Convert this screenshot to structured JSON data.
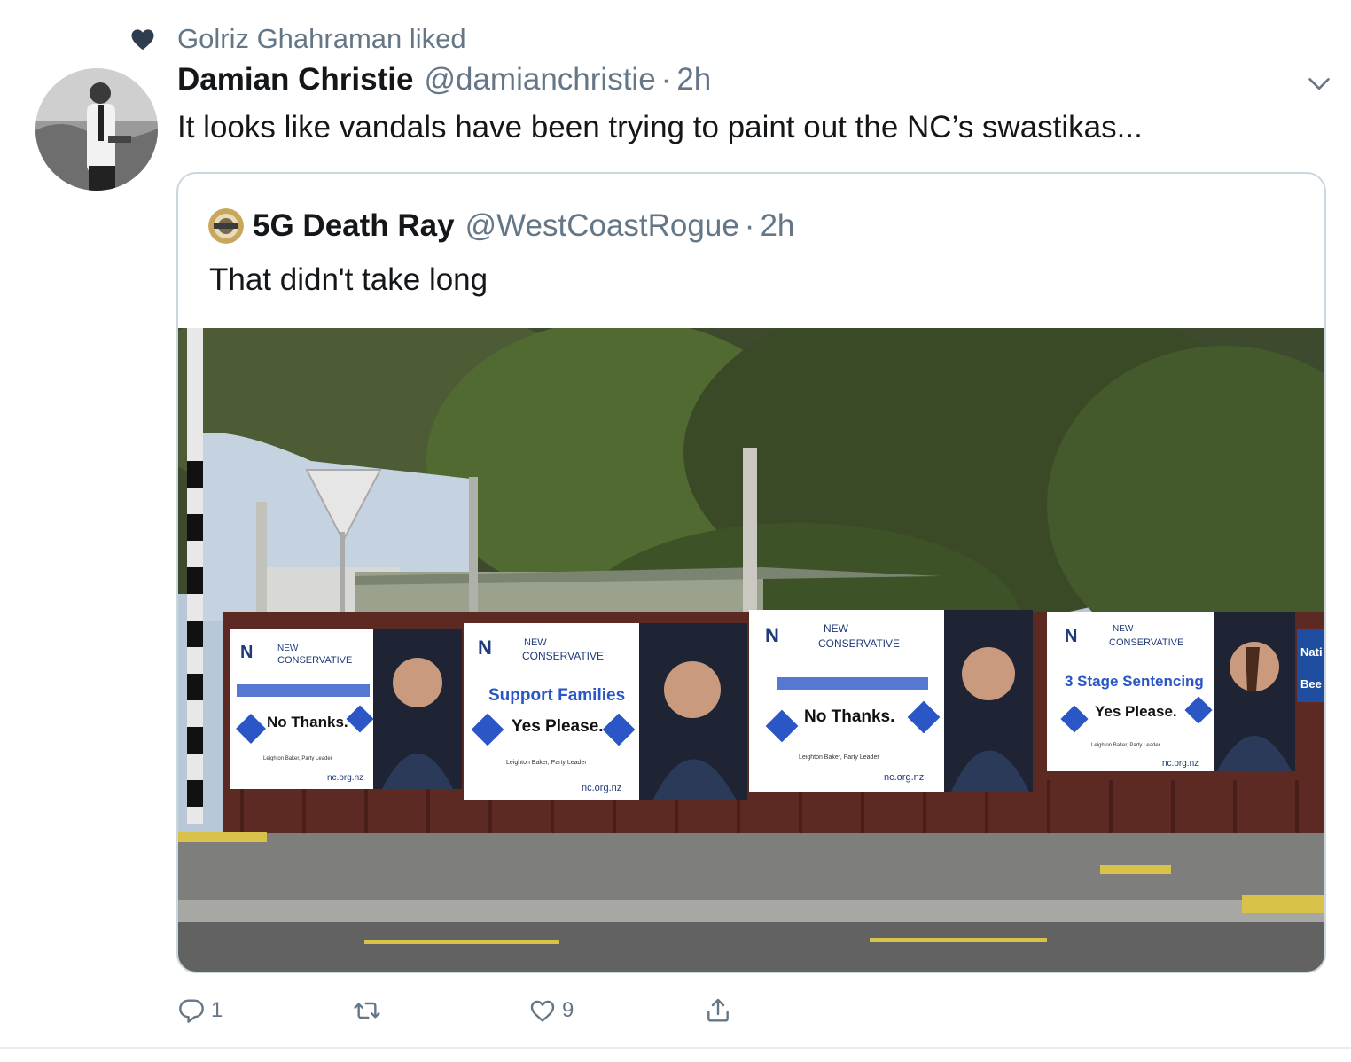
{
  "context": {
    "icon": "heart-icon",
    "text": "Golriz Ghahraman liked"
  },
  "tweet": {
    "author_name": "Damian Christie",
    "author_handle": "@damianchristie",
    "separator": "·",
    "time": "2h",
    "text": "It looks like vandals have been trying to paint out the NC’s swastikas..."
  },
  "quoted": {
    "author_name": "5G Death Ray",
    "author_handle": "@WestCoastRogue",
    "separator": "·",
    "time": "2h",
    "text": "That didn't take long"
  },
  "billboards": [
    {
      "party": "NEW",
      "party2": "CONSERVATIVE",
      "slogan_answer": "No Thanks.",
      "leader": "Leighton Baker, Party Leader",
      "url": "nc.org.nz"
    },
    {
      "party": "NEW",
      "party2": "CONSERVATIVE",
      "slogan": "Support Families",
      "slogan_answer": "Yes Please.",
      "leader": "Leighton Baker, Party Leader",
      "url": "nc.org.nz"
    },
    {
      "party": "NEW",
      "party2": "CONSERVATIVE",
      "slogan_answer": "No Thanks.",
      "leader": "Leighton Baker, Party Leader",
      "url": "nc.org.nz"
    },
    {
      "party": "NEW",
      "party2": "CONSERVATIVE",
      "slogan": "3 Stage Sentencing",
      "slogan_answer": "Yes Please.",
      "leader": "Leighton Baker, Party Leader",
      "url": "nc.org.nz"
    }
  ],
  "edge_sign": {
    "line1": "Nati",
    "line2": "Bee"
  },
  "actions": {
    "reply_count": "1",
    "retweet_count": "",
    "like_count": "9",
    "share_count": ""
  },
  "colors": {
    "secondary_text": "#657786",
    "primary_text": "#14171a",
    "border": "#ccd6dd",
    "heart_dark": "#2f3e4f"
  }
}
